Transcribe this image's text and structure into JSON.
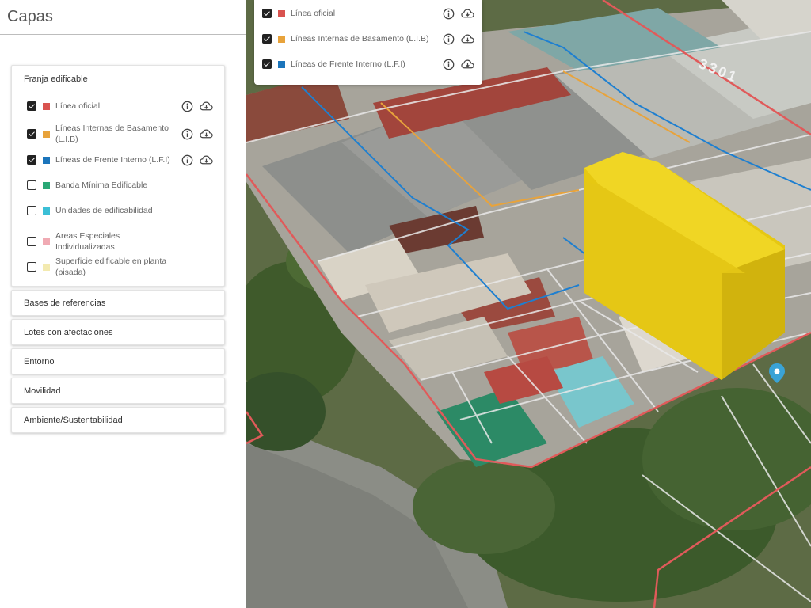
{
  "panel": {
    "title": "Capas",
    "open_section": {
      "title": "Franja edificable",
      "layers": [
        {
          "label": "Línea oficial",
          "checked": true,
          "color": "#d9534f",
          "actions": true
        },
        {
          "label": "Líneas Internas de Basamento (L.I.B)",
          "checked": true,
          "color": "#e8a33b",
          "actions": true
        },
        {
          "label": "Líneas de Frente Interno (L.F.I)",
          "checked": true,
          "color": "#1b75bb",
          "actions": true
        },
        {
          "label": "Banda Mínima Edificable",
          "checked": false,
          "color": "#2aa876",
          "actions": false
        },
        {
          "label": "Unidades de edificabilidad",
          "checked": false,
          "color": "#3bbfd6",
          "actions": false
        },
        {
          "label": "Areas Especiales Individualizadas",
          "checked": false,
          "color": "#f0aab3",
          "actions": false
        },
        {
          "label": "Superficie edificable en planta (pisada)",
          "checked": false,
          "color": "#f3eab0",
          "actions": false
        }
      ]
    },
    "sections": [
      {
        "title": "Bases de referencias"
      },
      {
        "title": "Lotes con afectaciones"
      },
      {
        "title": "Entorno"
      },
      {
        "title": "Movilidad"
      },
      {
        "title": "Ambiente/Sustentabilidad"
      }
    ]
  },
  "map_legend": {
    "layers": [
      {
        "label": "Línea oficial",
        "checked": true,
        "color": "#d9534f"
      },
      {
        "label": "Líneas Internas de Basamento (L.I.B)",
        "checked": true,
        "color": "#e8a33b"
      },
      {
        "label": "Líneas de Frente Interno (L.F.I)",
        "checked": true,
        "color": "#1b75bb"
      }
    ]
  },
  "map": {
    "street_number": "3301",
    "colors": {
      "official_line": "#e05a5a",
      "lib_line": "#e8a33b",
      "lfi_line": "#1e7fd0",
      "building_volume": "#e8c816",
      "marker": "#3aa3d6"
    },
    "icons": [
      "info-icon",
      "cloud-download-icon",
      "location-pin-icon"
    ]
  }
}
